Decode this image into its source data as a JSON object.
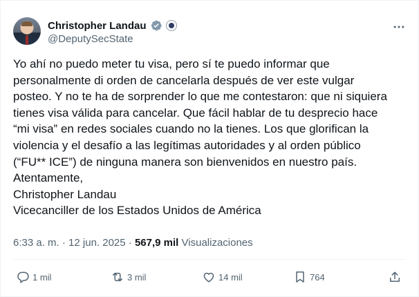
{
  "author": {
    "display_name": "Christopher Landau",
    "handle": "@DeputySecState",
    "verified_color": "#829aab"
  },
  "tweet": {
    "lines": [
      "Yo ahí no puedo meter tu visa, pero sí te puedo informar que",
      "personalmente di orden de cancelarla después de ver este vulgar",
      "posteo. Y no te ha de sorprender lo que me contestaron: que ni siquiera",
      "tienes visa válida para cancelar. Que fácil hablar de tu desprecio hace",
      "“mi visa” en redes sociales cuando no la tienes. Los que glorifican la",
      "violencia y el desafío a las legítimas autoridades y al orden público",
      "(“FU** ICE”) de ninguna manera son bienvenidos en nuestro país.",
      "Atentamente,",
      "Christopher Landau",
      "Vicecanciller de los Estados Unidos de América"
    ]
  },
  "meta": {
    "time": "6:33 a. m.",
    "separator": "·",
    "date": "12 jun. 2025",
    "views_count": "567,9 mil",
    "views_label": "Visualizaciones"
  },
  "actions": {
    "replies": "1 mil",
    "reposts": "3 mil",
    "likes": "14 mil",
    "bookmarks": "764"
  },
  "icons": [
    "more-icon",
    "verified-icon",
    "seal-icon",
    "reply-icon",
    "repost-icon",
    "like-icon",
    "bookmark-icon",
    "share-icon"
  ],
  "colors": {
    "text": "#0f1419",
    "secondary": "#536471",
    "divider": "#eff3f4"
  }
}
